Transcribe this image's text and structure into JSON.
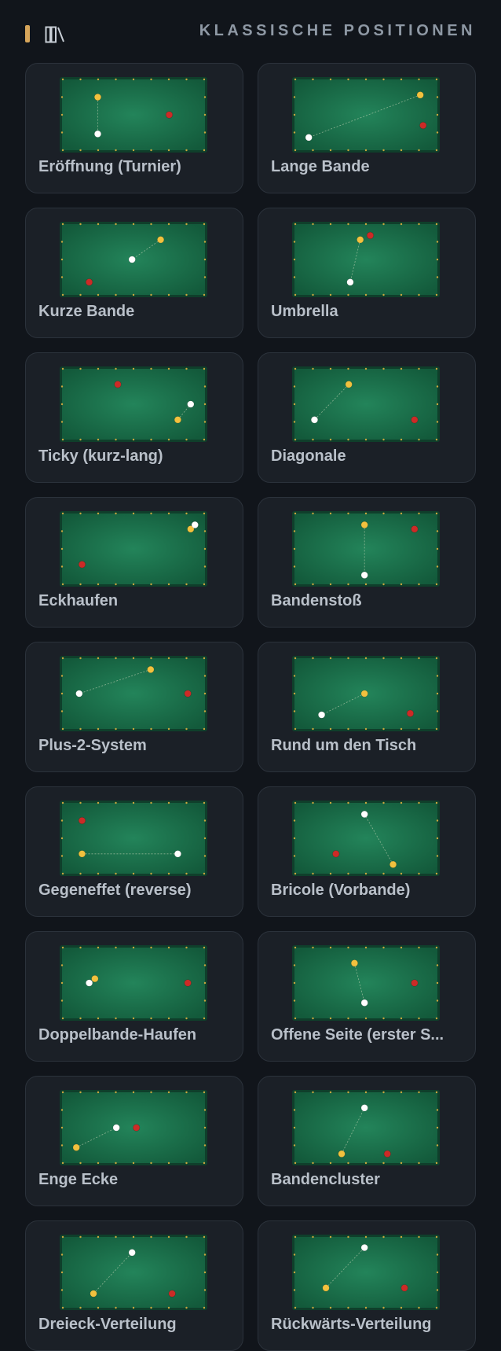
{
  "header": {
    "title": "KLASSISCHE POSITIONEN",
    "icon": "library-icon",
    "accent_color": "#d6a55a"
  },
  "colors": {
    "felt": "#1c6b48",
    "rail": "#0f3f2b",
    "diamond": "#c9a63e",
    "cue_ball_white": "#ffffff",
    "cue_ball_yellow": "#f2c13e",
    "object_ball_red": "#cc2b27"
  },
  "positions": [
    {
      "label": "Eröffnung (Turnier)",
      "balls": {
        "yellow": [
          0.25,
          0.25
        ],
        "white": [
          0.25,
          0.77
        ],
        "red": [
          0.75,
          0.5
        ]
      },
      "line": [
        "yellow",
        "white"
      ]
    },
    {
      "label": "Lange Bande",
      "balls": {
        "yellow": [
          0.88,
          0.22
        ],
        "white": [
          0.1,
          0.82
        ],
        "red": [
          0.9,
          0.65
        ]
      },
      "line": [
        "yellow",
        "white"
      ]
    },
    {
      "label": "Kurze Bande",
      "balls": {
        "yellow": [
          0.69,
          0.22
        ],
        "white": [
          0.49,
          0.5
        ],
        "red": [
          0.19,
          0.82
        ]
      },
      "line": [
        "yellow",
        "white"
      ]
    },
    {
      "label": "Umbrella",
      "balls": {
        "yellow": [
          0.46,
          0.22
        ],
        "white": [
          0.39,
          0.82
        ],
        "red": [
          0.53,
          0.16
        ]
      },
      "line": [
        "yellow",
        "white"
      ]
    },
    {
      "label": "Ticky (kurz-lang)",
      "balls": {
        "yellow": [
          0.81,
          0.72
        ],
        "white": [
          0.9,
          0.5
        ],
        "red": [
          0.39,
          0.22
        ]
      },
      "line": [
        "yellow",
        "white"
      ]
    },
    {
      "label": "Diagonale",
      "balls": {
        "yellow": [
          0.38,
          0.22
        ],
        "white": [
          0.14,
          0.72
        ],
        "red": [
          0.84,
          0.72
        ]
      },
      "line": [
        "yellow",
        "white"
      ]
    },
    {
      "label": "Eckhaufen",
      "balls": {
        "yellow": [
          0.9,
          0.22
        ],
        "white": [
          0.93,
          0.16
        ],
        "red": [
          0.14,
          0.72
        ]
      },
      "line": [
        "yellow",
        "white"
      ]
    },
    {
      "label": "Bandenstoß",
      "balls": {
        "yellow": [
          0.49,
          0.16
        ],
        "white": [
          0.49,
          0.87
        ],
        "red": [
          0.84,
          0.22
        ]
      },
      "line": [
        "yellow",
        "white"
      ]
    },
    {
      "label": "Plus-2-System",
      "balls": {
        "yellow": [
          0.62,
          0.16
        ],
        "white": [
          0.12,
          0.5
        ],
        "red": [
          0.88,
          0.5
        ]
      },
      "line": [
        "yellow",
        "white"
      ]
    },
    {
      "label": "Rund um den Tisch",
      "balls": {
        "yellow": [
          0.49,
          0.5
        ],
        "white": [
          0.19,
          0.8
        ],
        "red": [
          0.81,
          0.78
        ]
      },
      "line": [
        "yellow",
        "white"
      ]
    },
    {
      "label": "Gegeneffet (reverse)",
      "balls": {
        "yellow": [
          0.14,
          0.72
        ],
        "white": [
          0.81,
          0.72
        ],
        "red": [
          0.14,
          0.25
        ]
      },
      "line": [
        "yellow",
        "white"
      ]
    },
    {
      "label": "Bricole (Vorbande)",
      "balls": {
        "yellow": [
          0.69,
          0.87
        ],
        "white": [
          0.49,
          0.16
        ],
        "red": [
          0.29,
          0.72
        ]
      },
      "line": [
        "yellow",
        "white"
      ]
    },
    {
      "label": "Doppelbande-Haufen",
      "balls": {
        "yellow": [
          0.23,
          0.44
        ],
        "white": [
          0.19,
          0.5
        ],
        "red": [
          0.88,
          0.5
        ]
      },
      "line": [
        "yellow",
        "white"
      ]
    },
    {
      "label": "Offene Seite (erster S...",
      "balls": {
        "yellow": [
          0.42,
          0.22
        ],
        "white": [
          0.49,
          0.78
        ],
        "red": [
          0.84,
          0.5
        ]
      },
      "line": [
        "yellow",
        "white"
      ]
    },
    {
      "label": "Enge Ecke",
      "balls": {
        "yellow": [
          0.1,
          0.78
        ],
        "white": [
          0.38,
          0.5
        ],
        "red": [
          0.52,
          0.5
        ]
      },
      "line": [
        "yellow",
        "white"
      ]
    },
    {
      "label": "Bandencluster",
      "balls": {
        "yellow": [
          0.33,
          0.87
        ],
        "white": [
          0.49,
          0.22
        ],
        "red": [
          0.65,
          0.87
        ]
      },
      "line": [
        "yellow",
        "white"
      ]
    },
    {
      "label": "Dreieck-Verteilung",
      "balls": {
        "yellow": [
          0.22,
          0.8
        ],
        "white": [
          0.49,
          0.22
        ],
        "red": [
          0.77,
          0.8
        ]
      },
      "line": [
        "yellow",
        "white"
      ]
    },
    {
      "label": "Rückwärts-Verteilung",
      "balls": {
        "yellow": [
          0.22,
          0.72
        ],
        "white": [
          0.49,
          0.15
        ],
        "red": [
          0.77,
          0.72
        ]
      },
      "line": [
        "yellow",
        "white"
      ]
    }
  ]
}
